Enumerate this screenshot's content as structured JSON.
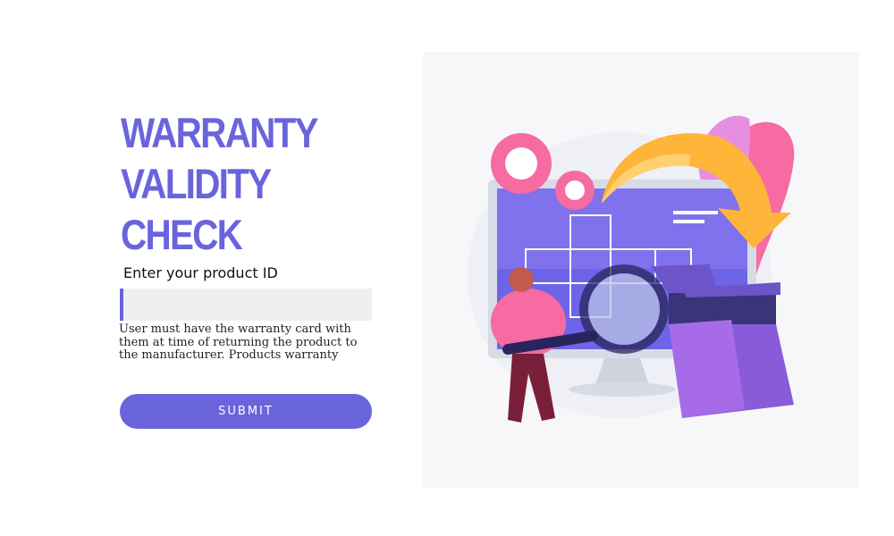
{
  "heading": {
    "line1": "WARRANTY",
    "line2": "VALIDITY",
    "line3": "CHECK"
  },
  "form": {
    "product_id_label": "Enter your product ID",
    "product_id_value": "",
    "help_text": "User must have the warranty card with them at  time of returning the product to the manufacturer. Products warranty",
    "submit_label": "SUBMIT"
  },
  "colors": {
    "accent": "#6a64dc",
    "input_bg": "#efefef"
  },
  "icons": [
    "warranty-check-illustration",
    "magnifier-icon",
    "gear-icon",
    "box-icon"
  ]
}
